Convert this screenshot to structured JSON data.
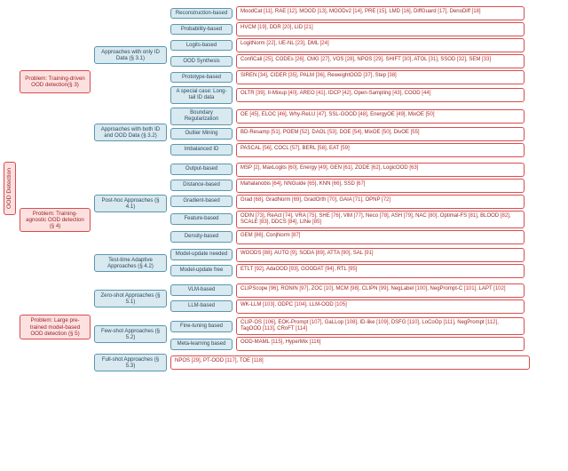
{
  "root": "OOD Detection",
  "l1": {
    "p1": "Problem: Training-driven OOD detection(§ 3)",
    "p2": "Problem: Training-agnostic OOD detection (§ 4)",
    "p3": "Problem: Large pre-trained model-based OOD detection (§ 5)"
  },
  "l2": {
    "a31": "Approaches with only ID Data (§ 3.1)",
    "a32": "Approaches with both ID and OOD Data (§ 3.2)",
    "a41": "Post-hoc Approaches (§ 4.1)",
    "a42": "Test-time Adaptive Approaches (§ 4.2)",
    "a51": "Zero-shot Approaches (§ 5.1)",
    "a52": "Few-shot Approaches (§ 5.2)",
    "a53": "Full-shot Approaches (§ 5.3)"
  },
  "l3": {
    "recon": "Reconstruction-based",
    "prob": "Probability-based",
    "logits": "Logits-based",
    "oodsyn": "OOD Synthesis",
    "proto": "Prototype-based",
    "special": "A special case: Long-tail ID data",
    "boundreg": "Boundary Regularization",
    "outmine": "Outlier Mining",
    "imbal": "Imbalanced ID",
    "output": "Output-based",
    "dist": "Distance-based",
    "grad": "Gradient-based",
    "feat": "Feature-based",
    "dens": "Density-based",
    "mupd": "Model-update needed",
    "mfree": "Model-update free",
    "vlm": "VLM-based",
    "llm": "LLM-based",
    "ft": "Fine-tuning based",
    "meta": "Meta-learning based"
  },
  "leaves": {
    "recon": "MoodCat [11], RAE [12], MOOD [13], MOODv2 [14], PRE [15], LMD [16], DiffGuard [17], DenoDiff [18]",
    "prob": "HVCM [19], DDR [20], LID [21]",
    "logits": "LogitNorm [22], UE-NL [23], DML [24]",
    "oodsyn": "ConfiCali [25], CODEs [26], CMG [27], VOS [28], NPOS [29], SHIFT [30], ATOL [31], SSOD [32], SEM [33]",
    "proto": "SIREN [34], CIDER [35], PALM [36], ReweightOOD [37], Step [38]",
    "special": "OLTR [39], II-Mixup [40], AREO [41], IDCP [42], Open-Sampling [43], COOD [44]",
    "boundreg": "OE [45], ELOC [46], Why-ReLU [47], SSL-GOOD [48], EnergyOE [49], MixOE [50]",
    "outmine": "BD-Resamp [51], POEM [52], DAOL [53], DOE [54], MixOE [50], DivOE [55]",
    "imbal": "PASCAL [56], COCL [57], BERL [58], EAT [59]",
    "output": "MSP [2], MaxLogits [60], Energy [49], GEN [61], ZODE [62], LogicOOD [63]",
    "dist": "Mahalanobis [64], NNGuide [65], KNN [66], SSD [67]",
    "grad": "Grad [68], GradNorm [69], GradOrth [70], GAIA [71], OPNP [72]",
    "feat": "ODIN [73], ReAct [74], VRA [75], SHE [76], ViM [77], Neco [78], ASH [79], NAC [80], Optimal-FS [81], BLOOD [82], SCALE [83], DDCS [84], LINe [85]",
    "dens": "GEM [86], ConjNorm [87]",
    "mupd": "WOODS [88],  AUTO [9], SODA [89], ATTA [90], SAL [91]",
    "mfree": "ETLT [92], AdaOOD [93], GOODAT [94], RTL [95]",
    "vlm": "CLIPScope [96], RONIN [97], ZOC [10], MCM [98], CLIPN [99], NegLabel [100], NegPrompt-C [101], LAPT [102]",
    "llm": "WK-LLM [103], ODPC [104], LLM-OOD [105]",
    "ft": "CLIP-OS [106], EOK-Prompt [107], GaLLop [108], ID-like [109], DSFG [110], LoCoOp [111], NegPrompt [112], TagOOD [113], CRoFT [114]",
    "meta": "OOD-MAML [115], HyperMix [116]",
    "full": "NPOS [29], PT-OOD [117], TOE [118]"
  }
}
